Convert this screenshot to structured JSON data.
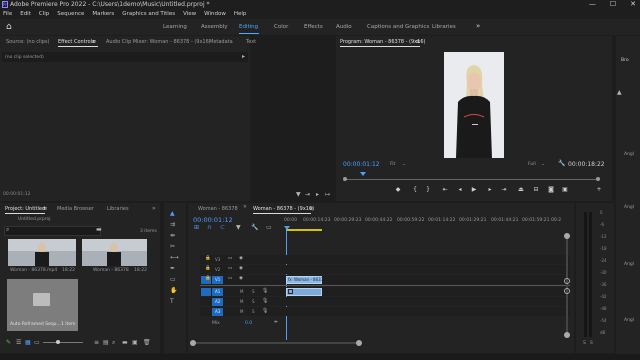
{
  "window": {
    "title": "Adobe Premiere Pro 2022 - C:\\Users\\1demo\\Music\\Untitled.prproj *",
    "controls": {
      "minimize": "—",
      "maximize": "☐",
      "close": "✕"
    }
  },
  "menu": [
    "File",
    "Edit",
    "Clip",
    "Sequence",
    "Markers",
    "Graphics and Titles",
    "View",
    "Window",
    "Help"
  ],
  "workspaces": {
    "items": [
      "Learning",
      "Assembly",
      "Editing",
      "Color",
      "Effects",
      "Audio",
      "Captions and Graphics",
      "Libraries"
    ],
    "active": "Editing",
    "more": "»"
  },
  "source_panel": {
    "tabs": [
      "Source: (no clips)",
      "Effect Controls",
      "Audio Clip Mixer: Woman - 86378 - (9x16)",
      "Metadata",
      "Text"
    ],
    "active_tab": "Effect Controls",
    "menu": "≡",
    "no_clip": "(no clip selected)",
    "timecode": "00:00:01:12"
  },
  "program_monitor": {
    "title": "Program: Woman - 86378 - (9x16)",
    "menu": "≡",
    "timecode": "00:00:01:12",
    "zoom": "Fit",
    "quality": "Full",
    "duration": "00:00:18:22"
  },
  "right_sidebar": {
    "label": "Bro",
    "labels": [
      "Angl",
      "Angl",
      "Angl",
      "Angl"
    ]
  },
  "project_panel": {
    "tabs": [
      "Project: Untitled",
      "Media Browser",
      "Libraries"
    ],
    "active_tab": "Project: Untitled",
    "menu": "≡",
    "more": "»",
    "file": "Untitled.prproj",
    "item_count": "3 items",
    "items": [
      {
        "name": "Woman - 86378.mp4",
        "duration": "18:22"
      },
      {
        "name": "Woman - 86378",
        "duration": "18:22"
      },
      {
        "name": "Auto Reframed Sequ...",
        "duration": "1 item"
      }
    ]
  },
  "timeline": {
    "tabs": [
      "Woman - 86378",
      "Woman - 86378 - (9x16)"
    ],
    "active_tab": "Woman - 86378 - (9x16)",
    "close": "✕",
    "menu": "≡",
    "timecode": "00:00:01:12",
    "ruler": [
      "00:00",
      "00:00:14:23",
      "00:00:29:23",
      "00:00:44:22",
      "00:00:59:22",
      "00:01:14:22",
      "00:01:29:21",
      "00:01:44:21",
      "00:01:59:21",
      "00:2"
    ],
    "tracks": {
      "video": [
        "V3",
        "V2",
        "V1"
      ],
      "audio": [
        "A1",
        "A2",
        "A3"
      ],
      "mix_label": "Mix",
      "mix_value": "0.0"
    },
    "clip": {
      "name": "Woman - 8637",
      "badge": "fx"
    }
  },
  "audio_meter": {
    "scale": [
      "0",
      "-6",
      "-12",
      "-18",
      "-24",
      "-30",
      "-36",
      "-42",
      "-48",
      "-54"
    ],
    "db_label": "dB",
    "solo": [
      "S",
      "S"
    ]
  },
  "colors": {
    "accent": "#4ea8ff",
    "clip": "#8ab8e8",
    "track_target": "#1f6bbf"
  }
}
